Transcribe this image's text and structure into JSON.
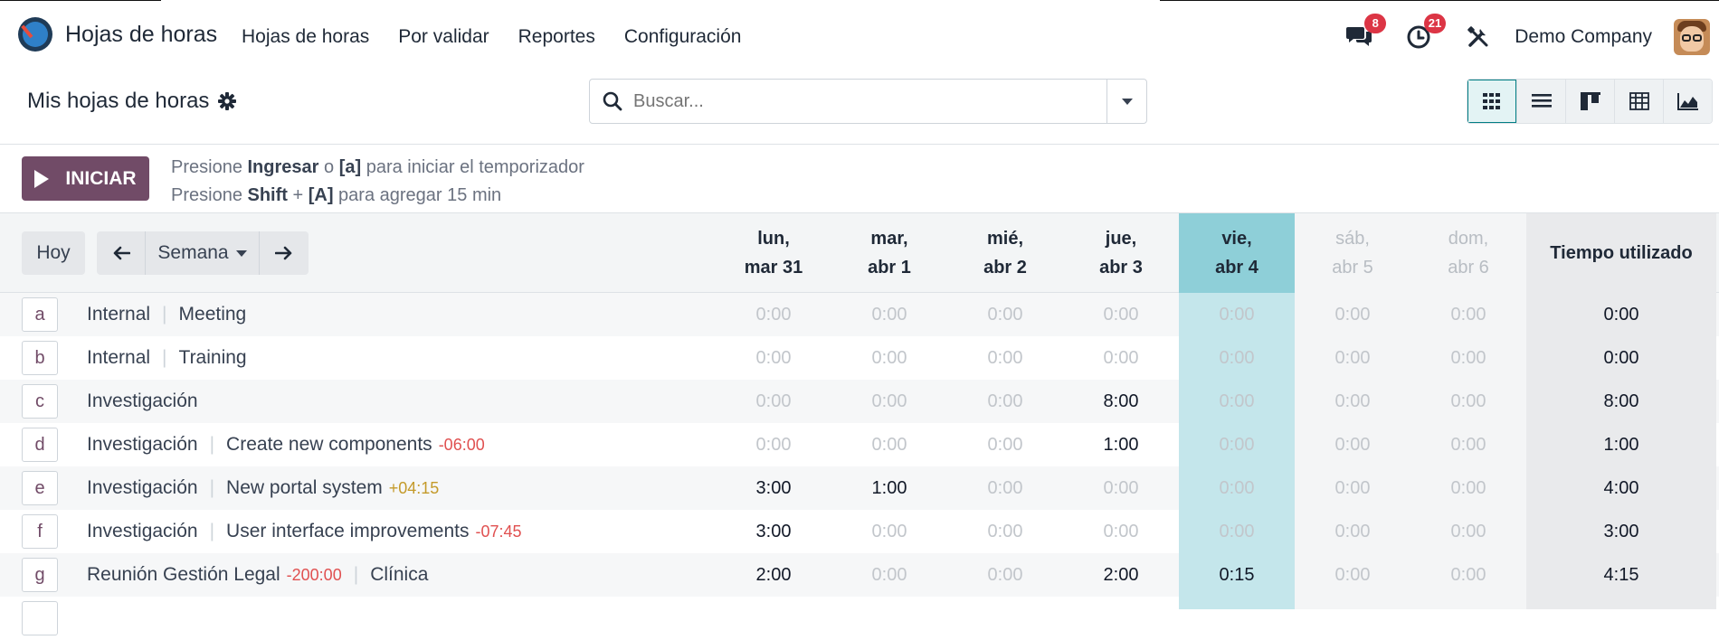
{
  "app": {
    "name": "Hojas de horas"
  },
  "menu": [
    "Hojas de horas",
    "Por validar",
    "Reportes",
    "Configuración"
  ],
  "notifications": {
    "messages": "8",
    "activities": "21"
  },
  "company": "Demo Company",
  "page_title": "Mis hojas de horas",
  "search": {
    "placeholder": "Buscar..."
  },
  "timer": {
    "start_label": "INICIAR",
    "hint1": {
      "a": "Presione ",
      "b": "Ingresar",
      "c": " o ",
      "d": "[a]",
      "e": " para iniciar el temporizador"
    },
    "hint2": {
      "a": "Presione ",
      "b": "Shift",
      "c": " + ",
      "d": "[A]",
      "e": " para agregar 15 min"
    }
  },
  "toolbar": {
    "today": "Hoy",
    "scale": "Semana"
  },
  "days": [
    {
      "l1": "lun,",
      "l2": "mar 31",
      "kind": "normal"
    },
    {
      "l1": "mar,",
      "l2": "abr 1",
      "kind": "normal"
    },
    {
      "l1": "mié,",
      "l2": "abr 2",
      "kind": "normal"
    },
    {
      "l1": "jue,",
      "l2": "abr 3",
      "kind": "normal"
    },
    {
      "l1": "vie,",
      "l2": "abr 4",
      "kind": "today"
    },
    {
      "l1": "sáb,",
      "l2": "abr 5",
      "kind": "weekend"
    },
    {
      "l1": "dom,",
      "l2": "abr 6",
      "kind": "weekend"
    }
  ],
  "total_header": "Tiempo utilizado",
  "rows": [
    {
      "key": "a",
      "project": "Internal",
      "project_overtime": "",
      "task": "Meeting",
      "task_overtime": "",
      "cells": [
        "0:00",
        "0:00",
        "0:00",
        "0:00",
        "0:00",
        "0:00",
        "0:00"
      ],
      "total": "0:00"
    },
    {
      "key": "b",
      "project": "Internal",
      "project_overtime": "",
      "task": "Training",
      "task_overtime": "",
      "cells": [
        "0:00",
        "0:00",
        "0:00",
        "0:00",
        "0:00",
        "0:00",
        "0:00"
      ],
      "total": "0:00"
    },
    {
      "key": "c",
      "project": "Investigación",
      "project_overtime": "",
      "task": "",
      "task_overtime": "",
      "cells": [
        "0:00",
        "0:00",
        "0:00",
        "8:00",
        "0:00",
        "0:00",
        "0:00"
      ],
      "total": "8:00"
    },
    {
      "key": "d",
      "project": "Investigación",
      "project_overtime": "",
      "task": "Create new components",
      "task_overtime": "-06:00",
      "cells": [
        "0:00",
        "0:00",
        "0:00",
        "1:00",
        "0:00",
        "0:00",
        "0:00"
      ],
      "total": "1:00"
    },
    {
      "key": "e",
      "project": "Investigación",
      "project_overtime": "",
      "task": "New portal system",
      "task_overtime": "+04:15",
      "cells": [
        "3:00",
        "1:00",
        "0:00",
        "0:00",
        "0:00",
        "0:00",
        "0:00"
      ],
      "total": "4:00"
    },
    {
      "key": "f",
      "project": "Investigación",
      "project_overtime": "",
      "task": "User interface improvements",
      "task_overtime": "-07:45",
      "cells": [
        "3:00",
        "0:00",
        "0:00",
        "0:00",
        "0:00",
        "0:00",
        "0:00"
      ],
      "total": "3:00"
    },
    {
      "key": "g",
      "project": "Reunión Gestión Legal",
      "project_overtime": "-200:00",
      "task": "Clínica",
      "task_overtime": "",
      "cells": [
        "2:00",
        "0:00",
        "0:00",
        "2:00",
        "0:15",
        "0:00",
        "0:00"
      ],
      "total": "4:15"
    }
  ],
  "colors": {
    "brand": "#714b67",
    "today_header": "#8ecfd8",
    "today_col": "#c4e6eb",
    "overtime_neg": "#e05050",
    "overtime_pos": "#c49a2a",
    "badge": "#dc3545"
  }
}
